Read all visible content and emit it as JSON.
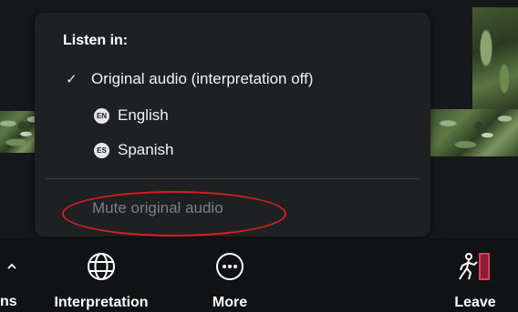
{
  "menu": {
    "title": "Listen in:",
    "items": [
      {
        "label": "Original audio (interpretation off)",
        "checked": true,
        "icon": "checkmark-icon"
      },
      {
        "label": "English",
        "badge": "EN",
        "icon": "language-badge-icon"
      },
      {
        "label": "Spanish",
        "badge": "ES",
        "icon": "language-badge-icon"
      }
    ],
    "mute_label": "Mute original audio"
  },
  "toolbar": {
    "partial_left_label": "ns",
    "buttons": [
      {
        "label": "Interpretation",
        "icon": "globe-icon"
      },
      {
        "label": "More",
        "icon": "more-dots-icon"
      },
      {
        "label": "Leave",
        "icon": "leave-door-icon"
      }
    ]
  },
  "colors": {
    "menu_bg": "#1f2022",
    "toolbar_bg": "#111214",
    "highlight_ellipse": "#d41f1f",
    "leave_accent": "#e33b5f",
    "disabled_text": "#7e7f83"
  }
}
